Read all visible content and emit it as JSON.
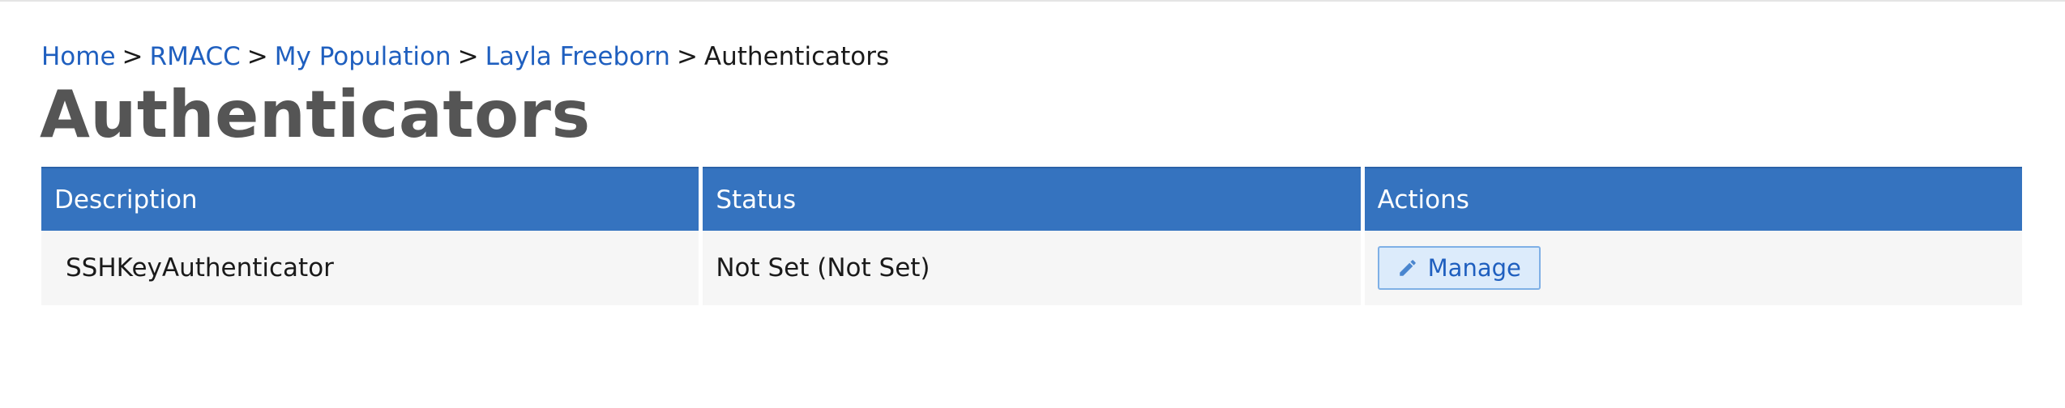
{
  "breadcrumb": {
    "items": [
      {
        "label": "Home"
      },
      {
        "label": "RMACC"
      },
      {
        "label": "My Population"
      },
      {
        "label": "Layla Freeborn"
      }
    ],
    "separator": ">",
    "current": "Authenticators"
  },
  "page": {
    "title": "Authenticators"
  },
  "table": {
    "headers": [
      "Description",
      "Status",
      "Actions"
    ],
    "rows": [
      {
        "description": "SSHKeyAuthenticator",
        "status": "Not Set (Not Set)",
        "action_label": "Manage",
        "action_icon": "pencil-icon"
      }
    ]
  },
  "colors": {
    "link": "#1f5fbf",
    "header_bg": "#3573bf",
    "title": "#555555",
    "row_bg": "#f6f6f6",
    "button_bg": "#dcebfb",
    "button_border": "#7fb0e6"
  }
}
